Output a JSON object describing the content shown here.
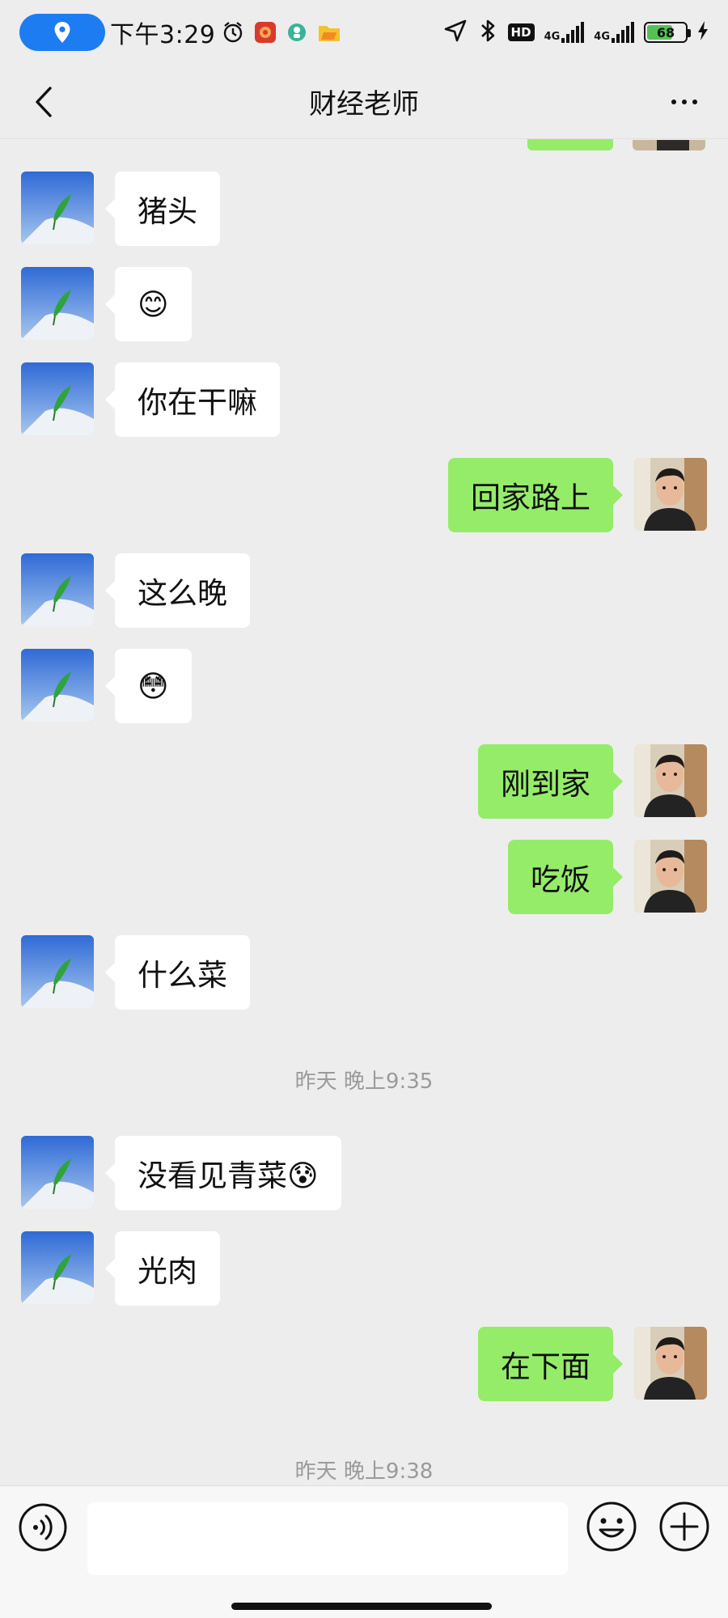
{
  "status_bar": {
    "time": "下午3:29",
    "network_label_1": "4G",
    "network_label_2": "4G",
    "hd_label": "HD",
    "battery_level": "68",
    "battery_fraction": 0.68
  },
  "header": {
    "title": "财经老师"
  },
  "messages": [
    {
      "side": "in",
      "text": "猪头"
    },
    {
      "side": "in",
      "text": "😊"
    },
    {
      "side": "in",
      "text": "你在干嘛"
    },
    {
      "side": "out",
      "text": "回家路上"
    },
    {
      "side": "in",
      "text": "这么晚"
    },
    {
      "side": "in",
      "text": "😳"
    },
    {
      "side": "out",
      "text": "刚到家"
    },
    {
      "side": "out",
      "text": "吃饭"
    },
    {
      "side": "in",
      "text": "什么菜"
    },
    {
      "side": "in",
      "text": "没看见青菜😰"
    },
    {
      "side": "in",
      "text": "光肉"
    },
    {
      "side": "out",
      "text": "在下面"
    }
  ],
  "timestamps": [
    "昨天 晚上9:35",
    "昨天 晚上9:38"
  ],
  "input": {
    "placeholder": "",
    "value": ""
  },
  "colors": {
    "background": "#ededed",
    "outgoing_bubble": "#95ec69",
    "incoming_bubble": "#ffffff",
    "location_pill": "#1e7cf2"
  }
}
